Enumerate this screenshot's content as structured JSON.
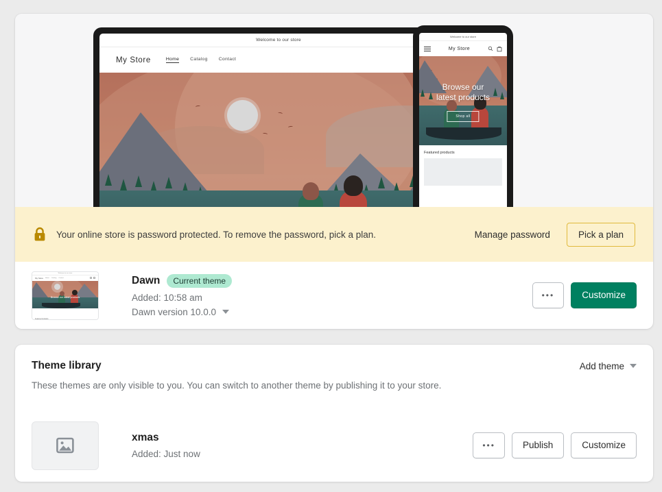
{
  "preview": {
    "desktop": {
      "announcement": "Welcome to our store",
      "logo": "My Store",
      "nav": [
        "Home",
        "Catalog",
        "Contact"
      ],
      "active_nav": "Home",
      "search_icon": "search-icon",
      "cart_icon": "cart-icon",
      "hero_heading": ""
    },
    "mobile": {
      "announcement": "Welcome to our store",
      "logo": "My Store",
      "menu_icon": "hamburger-menu-icon",
      "search_icon": "search-icon",
      "cart_icon": "cart-icon",
      "hero_heading_line1": "Browse our",
      "hero_heading_line2": "latest products",
      "hero_button": "Shop all",
      "featured_title": "Featured products"
    }
  },
  "banner": {
    "icon": "lock-icon",
    "message": "Your online store is password protected. To remove the password, pick a plan.",
    "manage_password_label": "Manage password",
    "pick_plan_label": "Pick a plan",
    "background_color": "#fcf1cd",
    "border_color": "#e0b93b"
  },
  "current_theme": {
    "name": "Dawn",
    "badge": "Current theme",
    "badge_color": "#aee9d1",
    "added": "Added: 10:58 am",
    "version": "Dawn version 10.0.0",
    "thumbnail": {
      "announcement": "Welcome to our store",
      "logo": "My Store",
      "nav": [
        "Home",
        "Catalog",
        "Contact"
      ],
      "hero_heading": "Browse our latest products",
      "featured_title": "Featured products"
    },
    "actions": {
      "more_label": "•••",
      "more_name": "more-actions-icon",
      "customize_label": "Customize",
      "customize_color": "#008060"
    }
  },
  "theme_library": {
    "title": "Theme library",
    "add_theme_label": "Add theme",
    "description": "These themes are only visible to you. You can switch to another theme by publishing it to your store.",
    "themes": [
      {
        "name": "xmas",
        "added": "Added: Just now",
        "thumbnail_icon": "image-placeholder-icon",
        "actions": {
          "more_label": "•••",
          "publish_label": "Publish",
          "customize_label": "Customize"
        }
      }
    ]
  }
}
